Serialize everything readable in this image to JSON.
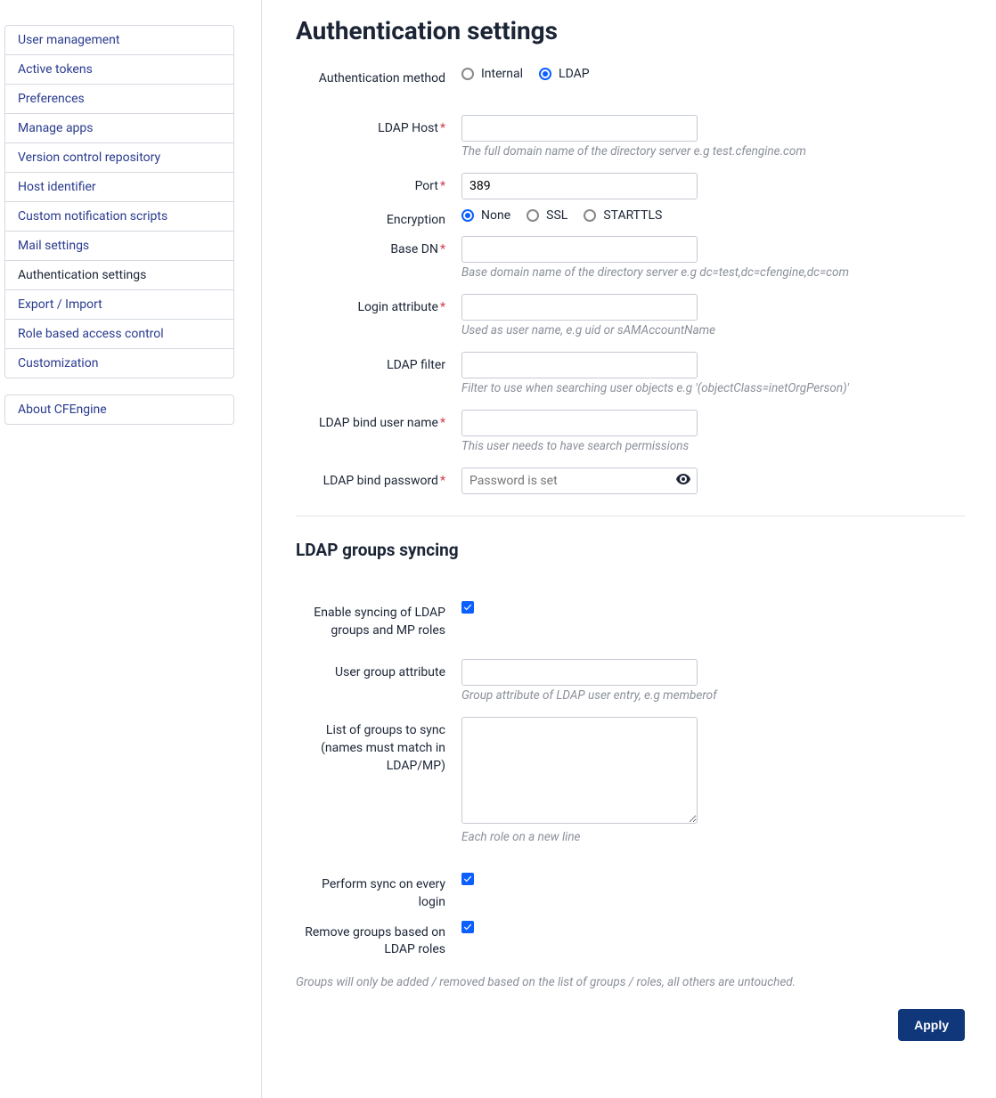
{
  "sidebar": {
    "items": [
      {
        "label": "User management"
      },
      {
        "label": "Active tokens"
      },
      {
        "label": "Preferences"
      },
      {
        "label": "Manage apps"
      },
      {
        "label": "Version control repository"
      },
      {
        "label": "Host identifier"
      },
      {
        "label": "Custom notification scripts"
      },
      {
        "label": "Mail settings"
      },
      {
        "label": "Authentication settings",
        "active": true
      },
      {
        "label": "Export / Import"
      },
      {
        "label": "Role based access control"
      },
      {
        "label": "Customization"
      }
    ],
    "about": "About CFEngine"
  },
  "page": {
    "title": "Authentication settings",
    "auth_method": {
      "label": "Authentication method",
      "internal": "Internal",
      "ldap": "LDAP"
    },
    "ldap_host": {
      "label": "LDAP Host",
      "help": "The full domain name of the directory server e.g test.cfengine.com"
    },
    "port": {
      "label": "Port",
      "value": "389"
    },
    "encryption": {
      "label": "Encryption",
      "none": "None",
      "ssl": "SSL",
      "starttls": "STARTTLS"
    },
    "base_dn": {
      "label": "Base DN",
      "help": "Base domain name of the directory server e.g dc=test,dc=cfengine,dc=com"
    },
    "login_attr": {
      "label": "Login attribute",
      "help": "Used as user name, e.g uid or sAMAccountName"
    },
    "ldap_filter": {
      "label": "LDAP filter",
      "help": "Filter to use when searching user objects e.g '(objectClass=inetOrgPerson)'"
    },
    "bind_user": {
      "label": "LDAP bind user name",
      "help": "This user needs to have search permissions"
    },
    "bind_pw": {
      "label": "LDAP bind password",
      "placeholder": "Password is set"
    },
    "groups": {
      "title": "LDAP groups syncing",
      "enable": "Enable syncing of LDAP groups and MP roles",
      "user_group_attr": {
        "label": "User group attribute",
        "help": "Group attribute of LDAP user entry, e.g memberof"
      },
      "list": {
        "label": "List of groups to sync (names must match in LDAP/MP)",
        "help": "Each role on a new line"
      },
      "sync_login": "Perform sync on every login",
      "remove_groups": "Remove groups based on LDAP roles",
      "footer": "Groups will only be added / removed based on the list of groups / roles, all others are untouched."
    },
    "apply": "Apply"
  }
}
